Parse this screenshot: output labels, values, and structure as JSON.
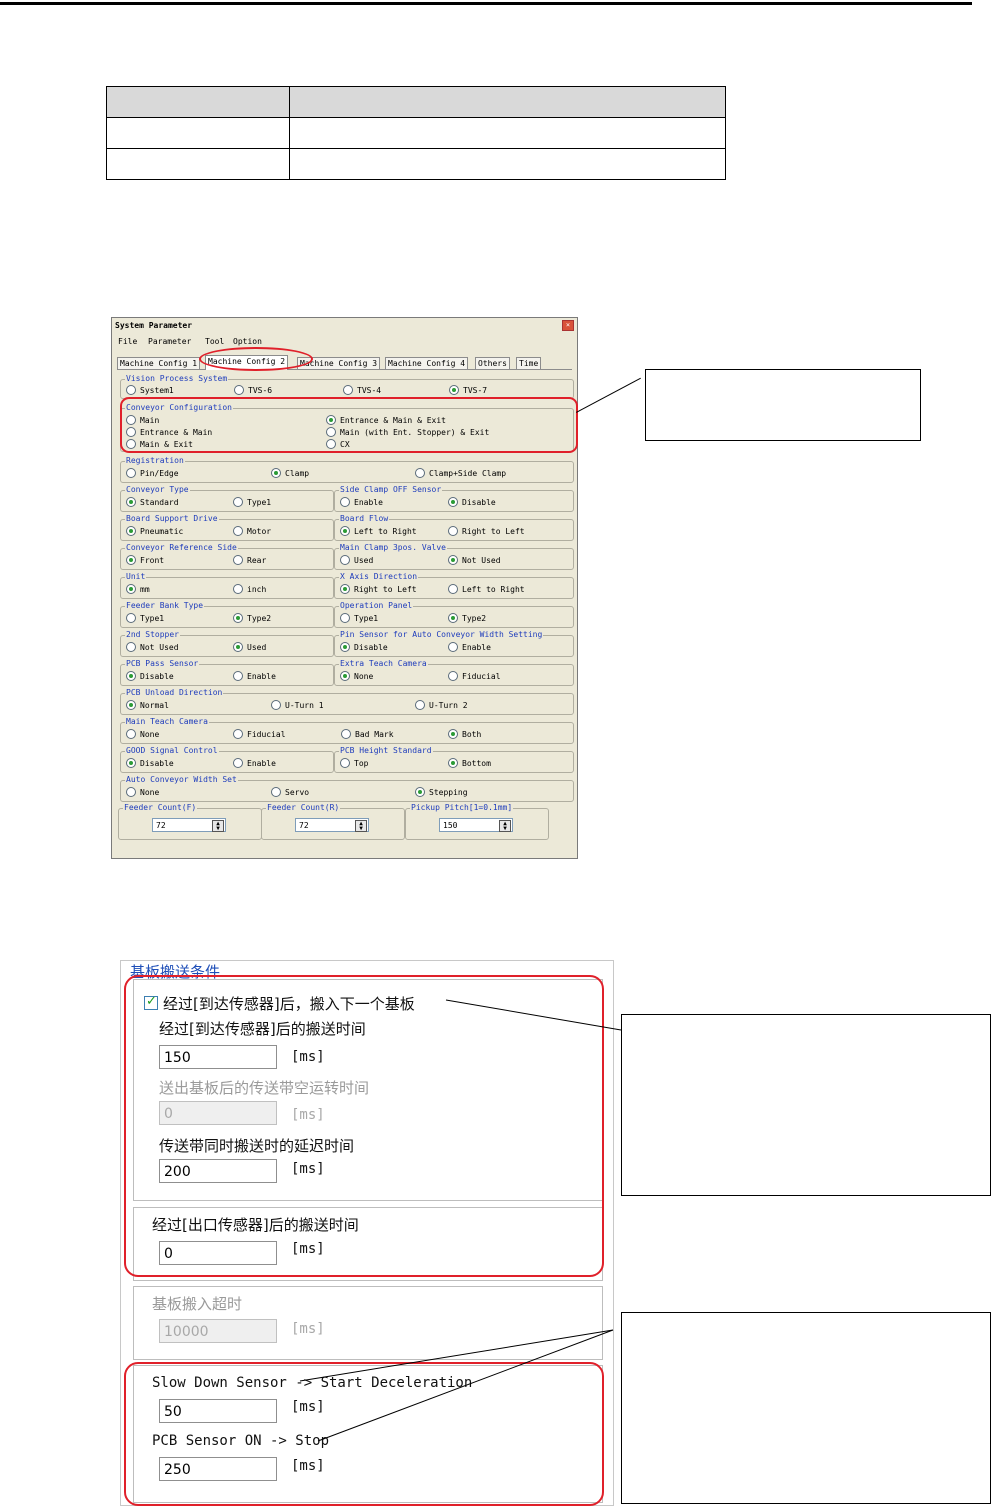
{
  "window": {
    "title": "System Parameter",
    "close_glyph": "×",
    "menu": [
      "File",
      "Parameter",
      "Tool",
      "Option"
    ],
    "tabs": [
      "Machine Config 1",
      "Machine Config 2",
      "Machine Config 3",
      "Machine Config 4",
      "Others",
      "Time"
    ],
    "active_tab": "Machine Config 2",
    "groups": {
      "vision": {
        "title": "Vision Process System",
        "options": [
          "System1",
          "TVS-6",
          "TVS-4",
          "TVS-7"
        ],
        "selected": "TVS-7"
      },
      "conveyor_config": {
        "title": "Conveyor Configuration",
        "options": [
          "Main",
          "Entrance & Main & Exit",
          "Entrance & Main",
          "Main (with Ent. Stopper) & Exit",
          "Main & Exit",
          "CX"
        ],
        "selected": "Entrance & Main & Exit"
      },
      "registration": {
        "title": "Registration",
        "options": [
          "Pin/Edge",
          "Clamp",
          "Clamp+Side Clamp"
        ],
        "selected": "Clamp"
      },
      "conveyor_type": {
        "title": "Conveyor Type",
        "options": [
          "Standard",
          "Type1"
        ],
        "selected": "Standard"
      },
      "side_clamp": {
        "title": "Side Clamp OFF Sensor",
        "options": [
          "Enable",
          "Disable"
        ],
        "selected": "Disable"
      },
      "board_support": {
        "title": "Board Support Drive",
        "options": [
          "Pneumatic",
          "Motor"
        ],
        "selected": "Pneumatic"
      },
      "board_flow": {
        "title": "Board Flow",
        "options": [
          "Left to Right",
          "Right to Left"
        ],
        "selected": "Left to Right"
      },
      "conveyor_ref": {
        "title": "Conveyor Reference Side",
        "options": [
          "Front",
          "Rear"
        ],
        "selected": "Front"
      },
      "main_clamp": {
        "title": "Main Clamp 3pos. Valve",
        "options": [
          "Used",
          "Not Used"
        ],
        "selected": "Not Used"
      },
      "unit": {
        "title": "Unit",
        "options": [
          "mm",
          "inch"
        ],
        "selected": "mm"
      },
      "x_axis": {
        "title": "X Axis Direction",
        "options": [
          "Right to Left",
          "Left to Right"
        ],
        "selected": "Right to Left"
      },
      "feeder_bank": {
        "title": "Feeder Bank Type",
        "options": [
          "Type1",
          "Type2"
        ],
        "selected": "Type2"
      },
      "operation_panel": {
        "title": "Operation Panel",
        "options": [
          "Type1",
          "Type2"
        ],
        "selected": "Type2"
      },
      "stopper2": {
        "title": "2nd Stopper",
        "options": [
          "Not Used",
          "Used"
        ],
        "selected": "Used"
      },
      "pin_sensor": {
        "title": "Pin Sensor for Auto Conveyor Width Setting",
        "options": [
          "Disable",
          "Enable"
        ],
        "selected": "Disable"
      },
      "pcb_pass": {
        "title": "PCB Pass Sensor",
        "options": [
          "Disable",
          "Enable"
        ],
        "selected": "Disable"
      },
      "extra_teach": {
        "title": "Extra Teach Camera",
        "options": [
          "None",
          "Fiducial"
        ],
        "selected": "None"
      },
      "unload_dir": {
        "title": "PCB Unload Direction",
        "options": [
          "Normal",
          "U-Turn 1",
          "U-Turn 2"
        ],
        "selected": "Normal"
      },
      "main_teach": {
        "title": "Main Teach Camera",
        "options": [
          "None",
          "Fiducial",
          "Bad Mark",
          "Both"
        ],
        "selected": "Both"
      },
      "good_signal": {
        "title": "GOOD Signal Control",
        "options": [
          "Disable",
          "Enable"
        ],
        "selected": "Disable"
      },
      "pcb_height": {
        "title": "PCB Height Standard",
        "options": [
          "Top",
          "Bottom"
        ],
        "selected": "Bottom"
      },
      "auto_width": {
        "title": "Auto Conveyor Width Set",
        "options": [
          "None",
          "Servo",
          "Stepping"
        ],
        "selected": "Stepping"
      }
    },
    "spinners": [
      {
        "title": "Feeder Count(F)",
        "value": "72"
      },
      {
        "title": "Feeder Count(R)",
        "value": "72"
      },
      {
        "title": "Pickup Pitch[1=0.1mm]",
        "value": "150"
      }
    ]
  },
  "panel": {
    "title": "基板搬送条件",
    "checkbox_label": "经过[到达传感器]后，搬入下一个基板",
    "fields": [
      {
        "label": "经过[到达传感器]后的搬送时间",
        "value": "150",
        "unit": "[ms]",
        "disabled": false
      },
      {
        "label": "送出基板后的传送带空运转时间",
        "value": "0",
        "unit": "[ms]",
        "disabled": true
      },
      {
        "label": "传送带同时搬送时的延迟时间",
        "value": "200",
        "unit": "[ms]",
        "disabled": false
      },
      {
        "label": "经过[出口传感器]后的搬送时间",
        "value": "0",
        "unit": "[ms]",
        "disabled": false
      },
      {
        "label": "基板搬入超时",
        "value": "10000",
        "unit": "[ms]",
        "disabled": true
      },
      {
        "label": "Slow Down Sensor -> Start Deceleration",
        "value": "50",
        "unit": "[ms]",
        "disabled": false
      },
      {
        "label": "PCB Sensor ON -> Stop",
        "value": "250",
        "unit": "[ms]",
        "disabled": false
      }
    ]
  },
  "colors": {
    "highlight": "#e0202a",
    "group_title": "#1e3cbc",
    "panel_title": "#1f4fb8",
    "radio_selected": "#2b9b36"
  }
}
